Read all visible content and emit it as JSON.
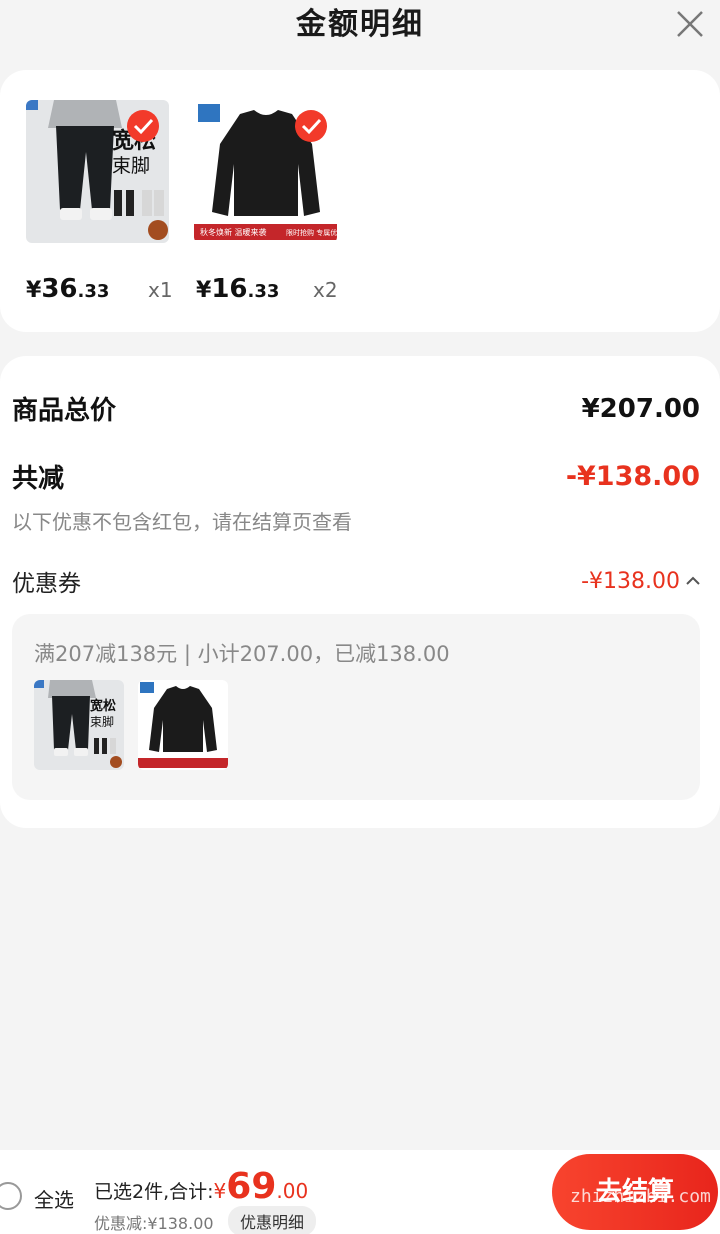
{
  "header": {
    "title": "金额明细"
  },
  "products": [
    {
      "image_text_big": "宽松",
      "image_text_sub": "束脚",
      "price_yen": "¥",
      "price_int": "36",
      "price_dec": ".33",
      "qty": "x1"
    },
    {
      "price_yen": "¥",
      "price_int": "16",
      "price_dec": ".33",
      "qty": "x2",
      "banner_left": "秋冬焕新 温暖来袭",
      "banner_right": "限时抢购 专属优惠"
    }
  ],
  "summary": {
    "total_label": "商品总价",
    "total_value": "¥207.00",
    "reduce_label": "共减",
    "reduce_value": "-¥138.00",
    "note": "以下优惠不包含红包，请在结算页查看",
    "coupon_label": "优惠券",
    "coupon_value": "-¥138.00",
    "coupon_desc": "满207减138元 | 小计207.00，已减138.00",
    "thumb_text_big": "宽松",
    "thumb_text_sub": "束脚"
  },
  "bottom": {
    "select_all": "全选",
    "selected_prefix": "已选2件,合计:",
    "total_yen": "¥",
    "total_int": "69",
    "total_dec": ".00",
    "discount": "优惠减:¥138.00",
    "detail_button": "优惠明细",
    "checkout": "去结算",
    "watermark": "zhizhizhi.com"
  },
  "colors": {
    "accent": "#e8321e",
    "check": "#f23a2a"
  }
}
